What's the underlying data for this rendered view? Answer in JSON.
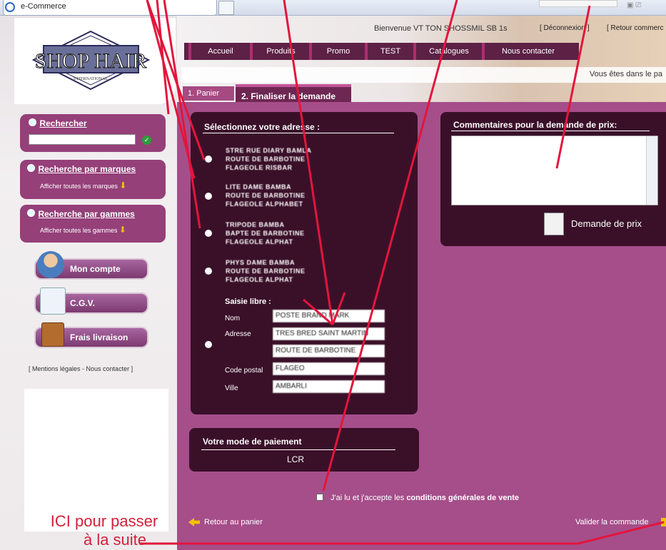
{
  "browser": {
    "tab_title": "e-Commerce"
  },
  "header": {
    "logo_text": "SHOP HAIR",
    "logo_subtext": "INTERNATIONAL",
    "welcome": "Bienvenue VT TON SHOSSMIL SB 1s",
    "logout": "[ Déconnexion ]",
    "back": "[ Retour commerc"
  },
  "nav": [
    "Accueil",
    "Produits",
    "Promo",
    "TEST",
    "Catalogues",
    "Nous contacter"
  ],
  "breadcrumb": "Vous êtes dans le pa",
  "tabs": {
    "cart": "1. Panier",
    "finalize": "2. Finaliser la demande"
  },
  "sidebar": {
    "search": {
      "title": "Rechercher",
      "go": "✓"
    },
    "brands": {
      "title": "Recherche par marques",
      "link": "Afficher toutes les marques"
    },
    "ranges": {
      "title": "Recherche par gammes",
      "link": "Afficher toutes les gammes"
    },
    "buttons": {
      "account": "Mon compte",
      "cgv": "C.G.V.",
      "shipping": "Frais livraison"
    },
    "footer_links": "[ Mentions légales - Nous contacter ]"
  },
  "address": {
    "title": "Sélectionnez votre adresse :",
    "options": [
      [
        "STRE RUE DIARY BAMLA",
        "ROUTE DE BARBOTINE",
        "FLAGEOLE RISBAR"
      ],
      [
        "LITE DAME BAMBA",
        "ROUTE DE BARBOTINE",
        "FLAGEOLE ALPHABET"
      ],
      [
        "TRIPODE BAMBA",
        "BAPTE DE BARBOTINE",
        "FLAGEOLE ALPHAT"
      ],
      [
        "PHYS DAME BAMBA",
        "ROUTE DE BARBOTINE",
        "FLAGEOLE ALPHAT"
      ]
    ],
    "free_entry": {
      "title": "Saisie libre :",
      "labels": {
        "name": "Nom",
        "address": "Adresse",
        "postal": "Code postal",
        "city": "Ville"
      },
      "values": {
        "name": "POSTE BRAND MARK",
        "address1": "TRES BRED SAINT MARTIN",
        "address2": "ROUTE DE BARBOTINE",
        "postal": "FLAGEO",
        "city": "AMBARLI"
      }
    }
  },
  "comments": {
    "title": "Commentaires pour la demande de prix:",
    "value": ""
  },
  "price_request": "Demande de prix",
  "payment": {
    "title": "Votre mode de paiement",
    "value": "LCR"
  },
  "cgv": {
    "prefix": "J'ai lu et j'accepte les ",
    "bold": "conditions générales de vente"
  },
  "footer": {
    "back_to_cart": "Retour au panier",
    "validate": "Valider la commande"
  },
  "annotation": {
    "line1": "ICI pour passer",
    "line2": "à la suite"
  },
  "colors": {
    "panel_dark": "#3a1029",
    "content_purple": "#a54e8a",
    "nav": "#5c2145",
    "annotation_red": "#d2203a"
  }
}
